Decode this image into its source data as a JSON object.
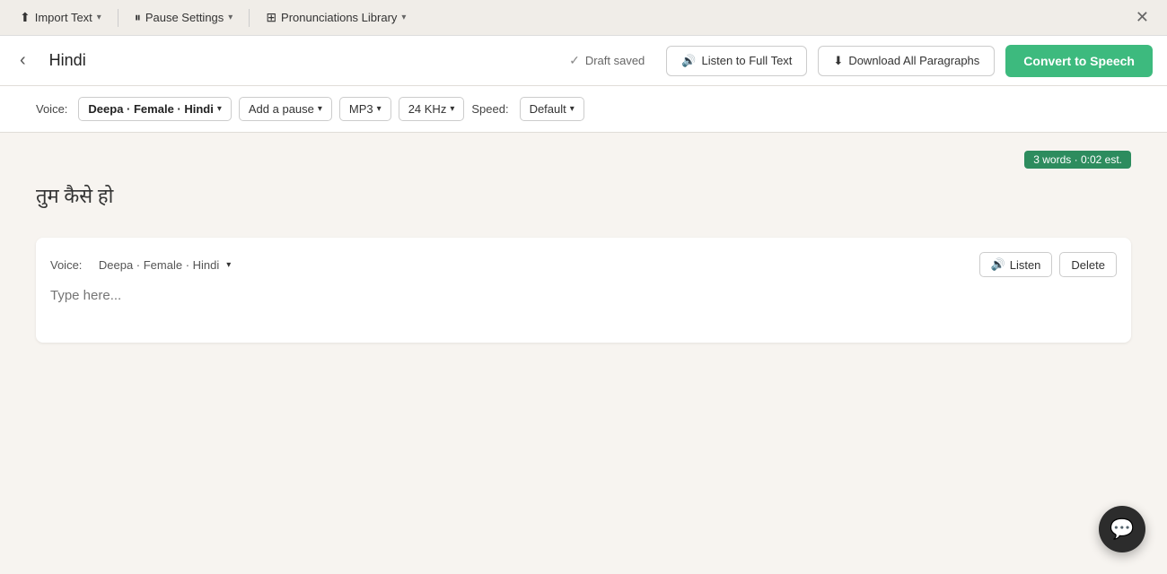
{
  "topNav": {
    "importText": "Import Text",
    "pauseSettings": "Pause Settings",
    "pronunciationsLibrary": "Pronunciations Library",
    "importIcon": "📤",
    "pauseIcon": "⏸",
    "pronunciationsIcon": "📚"
  },
  "header": {
    "title": "Hindi",
    "draftSaved": "Draft saved",
    "listenToFullText": "Listen to Full Text",
    "downloadAllParagraphs": "Download All Paragraphs",
    "convertToSpeech": "Convert to Speech"
  },
  "toolbar": {
    "voiceLabel": "Voice:",
    "voiceName": "Deepa · Female · Hindi",
    "addPause": "Add a pause",
    "format": "MP3",
    "quality": "24 KHz",
    "speedLabel": "Speed:",
    "speedValue": "Default"
  },
  "content": {
    "wordCount": "3 words",
    "timeEst": "0:02 est.",
    "mainText": "तुम कैसे हो",
    "paragraph": {
      "voiceLabel": "Voice:",
      "voiceName": "Deepa · Female · Hindi",
      "listenBtn": "Listen",
      "deleteBtn": "Delete",
      "placeholder": "Type here..."
    }
  }
}
